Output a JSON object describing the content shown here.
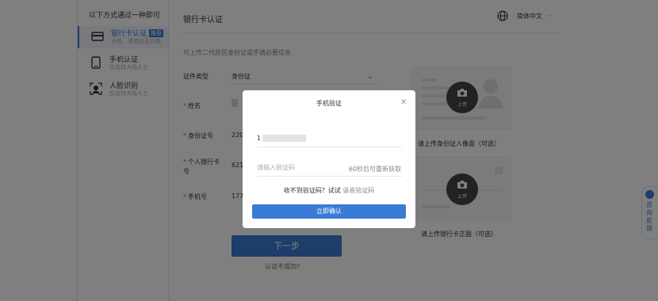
{
  "sidebar": {
    "title": "以下方式通过一种即可",
    "items": [
      {
        "label": "银行卡认证",
        "badge": "推荐",
        "sub": "大陆、港澳台及外籍",
        "icon": "bank-card-icon"
      },
      {
        "label": "手机认证",
        "sub": "仅支持大陆人士",
        "icon": "mobile-phone-icon"
      },
      {
        "label": "人脸识别",
        "sub": "仅支持大陆人士",
        "icon": "face-scan-icon"
      }
    ]
  },
  "header": {
    "title": "银行卡认证",
    "language": "简体中文"
  },
  "form": {
    "hint": "可上传二代居民身份证或手填必要信息",
    "id_type": {
      "label": "证件类型",
      "value": "身份证"
    },
    "name": {
      "label": "姓名"
    },
    "id_number": {
      "label": "身份证号",
      "value": "220"
    },
    "bank_card": {
      "label_line1": "个人银行卡",
      "label_line2": "号",
      "value": "621"
    },
    "phone": {
      "label": "手机号",
      "value": "177"
    },
    "next_label": "下一步",
    "fail_link": "认证不成功?"
  },
  "cards": {
    "id_caption": "请上传身份证人像面（可选）",
    "bank_caption": "请上传银行卡正面（可选）",
    "upload_label": "上传"
  },
  "float_feedback": "咨询反馈",
  "modal": {
    "title": "手机验证",
    "phone_prefix": "1",
    "code_placeholder": "请输入验证码",
    "resend_label": "60秒后可重新获取",
    "no_code_label": "收不到验证码？试试",
    "voice_code_label": "语音验证码",
    "confirm_label": "立即确认"
  },
  "colors": {
    "primary": "#3a7bd5"
  }
}
